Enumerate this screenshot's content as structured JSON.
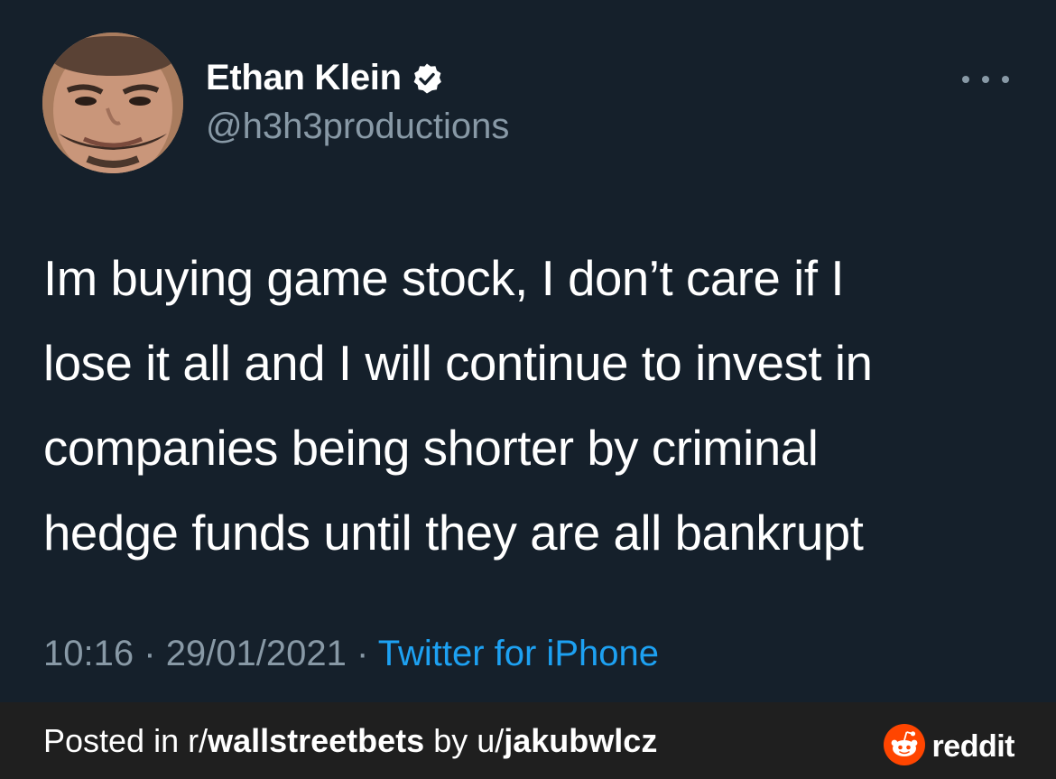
{
  "tweet": {
    "author": {
      "display_name": "Ethan Klein",
      "handle": "@h3h3productions",
      "verified": true
    },
    "text": "Im buying game stock, I don’t care if I\nlose it all and I will continue to invest in\ncompanies being shorter by criminal\nhedge funds until they are all bankrupt",
    "time": "10:16",
    "separator": "·",
    "date": "29/01/2021",
    "source": "Twitter for iPhone",
    "more_icon": "more-horizontal-icon"
  },
  "footer": {
    "posted_in_prefix": "Posted in r/",
    "subreddit": "wallstreetbets",
    "by_prefix": " by u/",
    "username": "jakubwlcz",
    "brand_wordmark": "reddit",
    "brand_icon": "reddit-snoo-icon"
  },
  "colors": {
    "background": "#15202b",
    "footer_background": "#1f1f1f",
    "secondary_text": "#8899a6",
    "link": "#1da1f2",
    "reddit_orange": "#ff4500"
  }
}
